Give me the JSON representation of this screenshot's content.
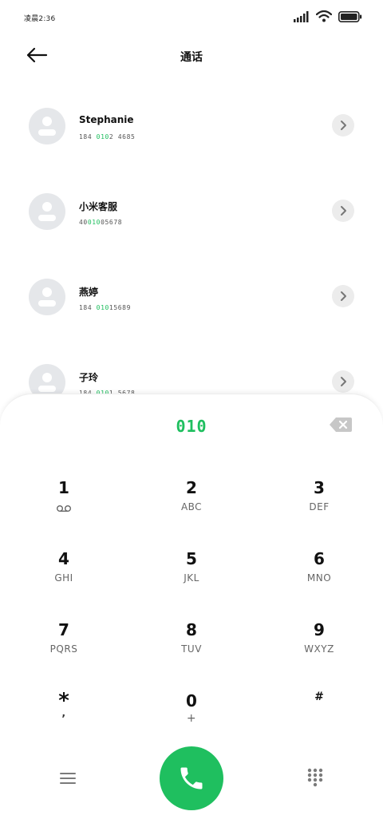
{
  "status_bar": {
    "time": "凌晨2:36",
    "icons": [
      "signal-icon",
      "wifi-icon",
      "battery-icon"
    ]
  },
  "header": {
    "title": "通话",
    "back_icon": "back-arrow-icon"
  },
  "contacts": [
    {
      "name": "Stephanie",
      "number_before": "184 ",
      "number_match": "010",
      "number_after": "2 4685"
    },
    {
      "name": "小米客服",
      "number_before": "40",
      "number_match": "010",
      "number_after": "05678"
    },
    {
      "name": "燕婷",
      "number_before": "184 ",
      "number_match": "010",
      "number_after": "15689"
    },
    {
      "name": "子玲",
      "number_before": "184 ",
      "number_match": "010",
      "number_after": "1 5678"
    }
  ],
  "dialpad": {
    "input": "010",
    "keys": [
      {
        "digit": "1",
        "letters": ""
      },
      {
        "digit": "2",
        "letters": "ABC"
      },
      {
        "digit": "3",
        "letters": "DEF"
      },
      {
        "digit": "4",
        "letters": "GHI"
      },
      {
        "digit": "5",
        "letters": "JKL"
      },
      {
        "digit": "6",
        "letters": "MNO"
      },
      {
        "digit": "7",
        "letters": "PQRS"
      },
      {
        "digit": "8",
        "letters": "TUV"
      },
      {
        "digit": "9",
        "letters": "WXYZ"
      },
      {
        "digit": "*",
        "letters": ","
      },
      {
        "digit": "0",
        "letters": "+"
      },
      {
        "digit": "#",
        "letters": ""
      }
    ]
  },
  "colors": {
    "accent": "#1fbf5f",
    "avatar_bg": "#e5e7ea",
    "chevron_bg": "#ececec"
  }
}
